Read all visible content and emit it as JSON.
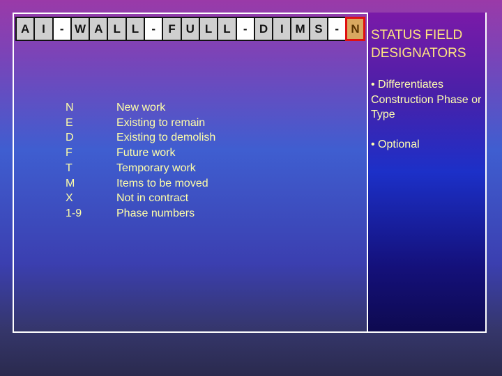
{
  "filename_cells": [
    "A",
    "I",
    "-",
    "W",
    "A",
    "L",
    "L",
    "-",
    "F",
    "U",
    "L",
    "L",
    "-",
    "D",
    "I",
    "M",
    "S",
    "-",
    "N"
  ],
  "panel": {
    "title_line1": "STATUS FIELD",
    "title_line2": "DESIGNATORS",
    "bullets": [
      "• Differentiates Construction Phase or Type",
      "• Optional"
    ]
  },
  "designators": [
    {
      "code": "N",
      "meaning": "New work"
    },
    {
      "code": "E",
      "meaning": "Existing to remain"
    },
    {
      "code": "D",
      "meaning": "Existing to demolish"
    },
    {
      "code": "F",
      "meaning": "Future work"
    },
    {
      "code": "T",
      "meaning": "Temporary work"
    },
    {
      "code": "M",
      "meaning": "Items to be moved"
    },
    {
      "code": "X",
      "meaning": "Not in contract"
    },
    {
      "code": "1-9",
      "meaning": "Phase numbers"
    }
  ],
  "colors": {
    "title": "#ffe680",
    "text": "#ffffa8",
    "highlight_border": "#e01010",
    "highlight_fill": "#d9a860"
  }
}
